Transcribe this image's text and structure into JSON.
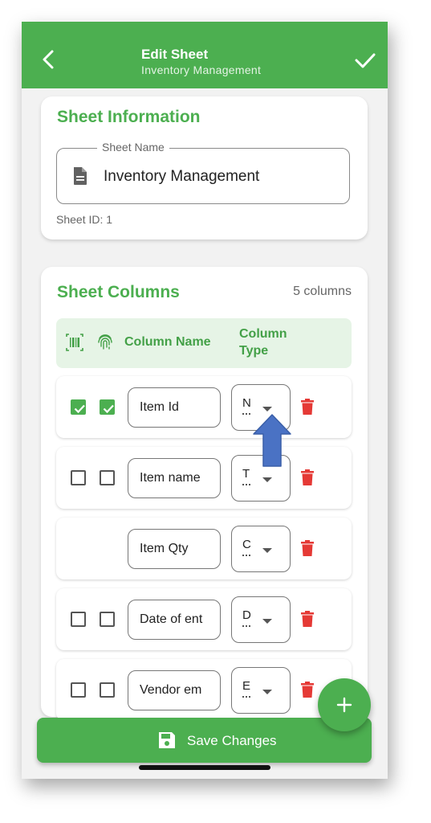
{
  "header": {
    "title": "Edit Sheet",
    "subtitle": "Inventory Management",
    "back_icon": "arrow-back-icon",
    "confirm_icon": "check-icon"
  },
  "sheet_info": {
    "title": "Sheet Information",
    "name_label": "Sheet Name",
    "name_value": "Inventory Management",
    "sheet_id": "Sheet ID: 1"
  },
  "columns": {
    "title": "Sheet Columns",
    "count": "5 columns",
    "header": {
      "barcode_icon": "barcode-icon",
      "fingerprint_icon": "fingerprint-icon",
      "name": "Column Name",
      "type_line1": "Column",
      "type_line2": "Type"
    },
    "rows": [
      {
        "name": "Item Id",
        "type": "N",
        "barcode": true,
        "unique": true
      },
      {
        "name": "Item name",
        "type": "T",
        "barcode": false,
        "unique": false
      },
      {
        "name": "Item Qty",
        "type": "C",
        "barcode": null,
        "unique": null
      },
      {
        "name": "Date of ent",
        "type": "D",
        "barcode": false,
        "unique": false
      },
      {
        "name": "Vendor em",
        "type": "E",
        "barcode": false,
        "unique": false
      }
    ]
  },
  "actions": {
    "save_label": "Save Changes",
    "add_icon": "plus-icon"
  },
  "colors": {
    "accent": "#4caf50",
    "delete": "#e53935",
    "annotation_arrow": "#4a72c4"
  }
}
